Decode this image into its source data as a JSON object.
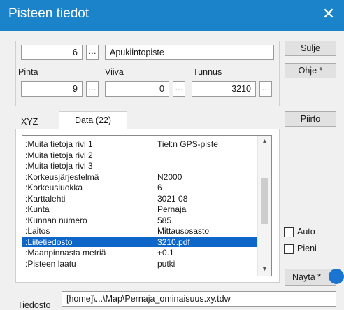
{
  "window": {
    "title": "Pisteen tiedot",
    "close_label": "✕"
  },
  "point": {
    "number": "6",
    "browse": "…",
    "description": "Apukiintopiste",
    "pinta_label": "Pinta",
    "pinta_value": "9",
    "viiva_label": "Viiva",
    "viiva_value": "0",
    "tunnus_label": "Tunnus",
    "tunnus_value": "3210"
  },
  "buttons": {
    "sulje": "Sulje",
    "ohje": "Ohje *",
    "piirto": "Piirto",
    "nayta": "Näytä *"
  },
  "tabs": [
    {
      "label": "XYZ"
    },
    {
      "label": "Data (22)"
    }
  ],
  "data_rows": [
    {
      "key": ":Muita tietoja rivi 1",
      "value": "Tiel:n GPS-piste"
    },
    {
      "key": ":Muita tietoja rivi 2",
      "value": ""
    },
    {
      "key": ":Muita tietoja rivi 3",
      "value": ""
    },
    {
      "key": ":Korkeusjärjestelmä",
      "value": "N2000"
    },
    {
      "key": ":Korkeusluokka",
      "value": "6"
    },
    {
      "key": ":Karttalehti",
      "value": "3021 08"
    },
    {
      "key": ":Kunta",
      "value": "Pernaja"
    },
    {
      "key": ":Kunnan numero",
      "value": "585"
    },
    {
      "key": ":Laitos",
      "value": "Mittausosasto"
    },
    {
      "key": ":Liitetiedosto",
      "value": "3210.pdf"
    },
    {
      "key": ":Maanpinnasta metriä",
      "value": "+0.1"
    },
    {
      "key": ":Pisteen laatu",
      "value": "putki"
    }
  ],
  "selected_row": 9,
  "options": {
    "auto_label": "Auto",
    "auto_checked": false,
    "pieni_label": "Pieni",
    "pieni_checked": false
  },
  "file": {
    "label": "Tiedosto",
    "path": "[home]\\...\\Map\\Pernaja_ominaisuus.xy.tdw"
  },
  "scroll_arrows": {
    "up": "▲",
    "down": "▼"
  },
  "colors": {
    "titlebar": "#1b83c9",
    "selection": "#0e67c8",
    "accent_dot": "#1b75d0"
  }
}
